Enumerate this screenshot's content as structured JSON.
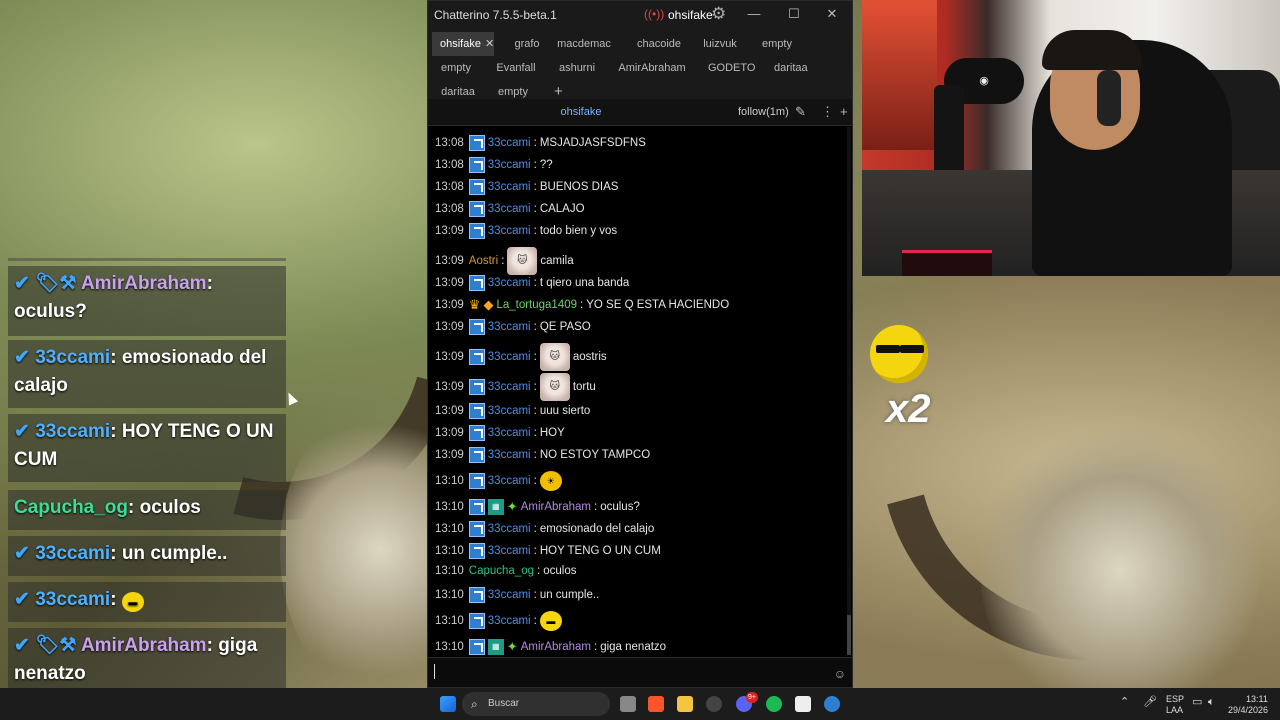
{
  "window": {
    "title": "Chatterino 7.5.5-beta.1",
    "live_user": "ohsifake",
    "tabs_row1": [
      "ohsifake",
      "grafo",
      "macdemac",
      "chacoide",
      "luizvuk",
      "empty"
    ],
    "tabs_row2": [
      "empty",
      "Evanfall",
      "ashurni",
      "AmirAbraham",
      "GODETO",
      "daritaa"
    ],
    "tabs_row3": [
      "daritaa",
      "empty"
    ],
    "selected_tab": "ohsifake",
    "split_channel": "ohsifake",
    "follow_mode": "follow(1m)"
  },
  "messages": [
    {
      "t": "13:08",
      "user": "33ccami",
      "badges": [
        "sub"
      ],
      "text": "MSJADJASFSDFNS"
    },
    {
      "t": "13:08",
      "user": "33ccami",
      "badges": [
        "sub"
      ],
      "text": "??"
    },
    {
      "t": "13:08",
      "user": "33ccami",
      "badges": [
        "sub"
      ],
      "text": "BUENOS DIAS"
    },
    {
      "t": "13:08",
      "user": "33ccami",
      "badges": [
        "sub"
      ],
      "text": "CALAJO"
    },
    {
      "t": "13:09",
      "user": "33ccami",
      "badges": [
        "sub"
      ],
      "text": "todo bien y vos"
    },
    {
      "t": "13:09",
      "user": "Aostri",
      "badges": [],
      "emote": "cat",
      "text": "camila"
    },
    {
      "t": "13:09",
      "user": "33ccami",
      "badges": [
        "sub"
      ],
      "text": "t qiero una banda"
    },
    {
      "t": "13:09",
      "user": "La_tortuga1409",
      "badges": [
        "crown",
        "box"
      ],
      "text": "YO SE Q ESTA HACIENDO"
    },
    {
      "t": "13:09",
      "user": "33ccami",
      "badges": [
        "sub"
      ],
      "text": "QE PASO"
    },
    {
      "t": "13:09",
      "user": "33ccami",
      "badges": [
        "sub"
      ],
      "emote": "cat",
      "text": "aostris"
    },
    {
      "t": "13:09",
      "user": "33ccami",
      "badges": [
        "sub"
      ],
      "emote": "cat",
      "text": "tortu"
    },
    {
      "t": "13:09",
      "user": "33ccami",
      "badges": [
        "sub"
      ],
      "text": "uuu sierto"
    },
    {
      "t": "13:09",
      "user": "33ccami",
      "badges": [
        "sub"
      ],
      "text": "HOY"
    },
    {
      "t": "13:09",
      "user": "33ccami",
      "badges": [
        "sub"
      ],
      "text": "NO ESTOY TAMPCO"
    },
    {
      "t": "13:10",
      "user": "33ccami",
      "badges": [
        "sub"
      ],
      "emote": "sun",
      "text": ""
    },
    {
      "t": "13:10",
      "user": "AmirAbraham",
      "badges": [
        "sub",
        "vip",
        "spark"
      ],
      "text": "oculus?"
    },
    {
      "t": "13:10",
      "user": "33ccami",
      "badges": [
        "sub"
      ],
      "text": "emosionado del calajo"
    },
    {
      "t": "13:10",
      "user": "33ccami",
      "badges": [
        "sub"
      ],
      "text": "HOY TENG O UN CUM"
    },
    {
      "t": "13:10",
      "user": "Capucha_og",
      "badges": [],
      "text": "oculos"
    },
    {
      "t": "13:10",
      "user": "33ccami",
      "badges": [
        "sub"
      ],
      "text": "un cumple.."
    },
    {
      "t": "13:10",
      "user": "33ccami",
      "badges": [
        "sub"
      ],
      "emote": "emo",
      "text": ""
    },
    {
      "t": "13:10",
      "user": "AmirAbraham",
      "badges": [
        "sub",
        "vip",
        "spark"
      ],
      "text": "giga nenatzo"
    }
  ],
  "overlay": [
    {
      "user": "AmirAbraham",
      "text": "oculus?",
      "badges": "✔ 🏷⚒"
    },
    {
      "user": "33ccami",
      "text": "emosionado del calajo",
      "badges": "✔"
    },
    {
      "user": "33ccami",
      "text": "HOY TENG O UN CUM",
      "badges": "✔"
    },
    {
      "user": "Capucha_og",
      "text": "oculos",
      "badges": ""
    },
    {
      "user": "33ccami",
      "text": "un cumple..",
      "badges": "✔"
    },
    {
      "user": "33ccami",
      "text": "",
      "badges": "✔"
    },
    {
      "user": "AmirAbraham",
      "text": "giga nenatzo",
      "badges": "✔ 🏷⚒"
    }
  ],
  "emote_overlay": {
    "multiplier": "x2"
  },
  "taskbar": {
    "search_placeholder": "Buscar",
    "lang1": "ESP",
    "lang2": "LAA",
    "time": "13:11",
    "date": "29/4/2026",
    "notification_badge": "9+"
  },
  "colors": {
    "sub_badge": "#2f7fd1",
    "name_33ccami": "#4f8fe0",
    "name_AmirAbraham": "#b38bdf",
    "name_Aostri": "#d49a2a",
    "name_La_tortuga1409": "#6bd16b",
    "name_Capucha_og": "#2ec08c"
  }
}
